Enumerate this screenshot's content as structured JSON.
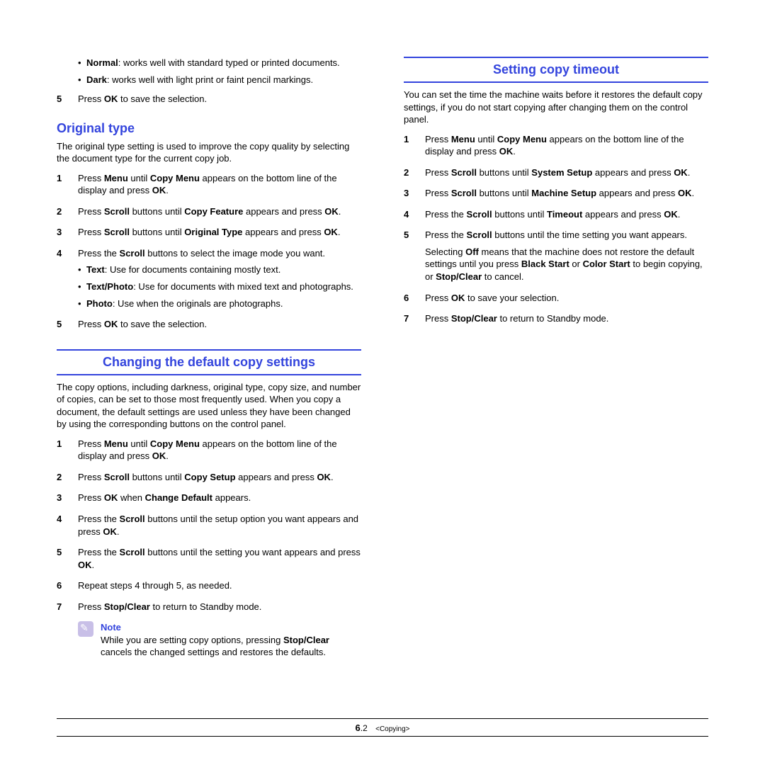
{
  "left": {
    "intro_bullets": [
      {
        "label": "Normal",
        "text": ": works well with standard typed or printed documents."
      },
      {
        "label": "Dark",
        "text": ": works well with light print or faint pencil markings."
      }
    ],
    "step5_a": "Press ",
    "step5_b": "OK",
    "step5_c": " to save the selection.",
    "original_heading": "Original type",
    "original_intro": "The original type setting is used to improve the copy quality by selecting the document type for the current copy job.",
    "o1_a": "Press ",
    "o1_b": "Menu",
    "o1_c": " until ",
    "o1_d": "Copy Menu",
    "o1_e": " appears on the bottom line of the display and press ",
    "o1_f": "OK",
    "o1_g": ".",
    "o2_a": "Press ",
    "o2_b": "Scroll",
    "o2_c": " buttons until ",
    "o2_d": "Copy Feature",
    "o2_e": " appears and press ",
    "o2_f": "OK",
    "o2_g": ".",
    "o3_a": "Press ",
    "o3_b": "Scroll",
    "o3_c": " buttons until ",
    "o3_d": "Original Type",
    "o3_e": " appears and press ",
    "o3_f": "OK",
    "o3_g": ".",
    "o4_a": "Press the ",
    "o4_b": "Scroll",
    "o4_c": " buttons to select the image mode you want.",
    "o4_bullets": [
      {
        "label": "Text",
        "text": ": Use for documents containing mostly text."
      },
      {
        "label": "Text/Photo",
        "text": ": Use for documents with mixed text and photographs."
      },
      {
        "label": "Photo",
        "text": ": Use when the originals are photographs."
      }
    ],
    "o5_a": "Press ",
    "o5_b": "OK",
    "o5_c": " to save the selection.",
    "changing_heading": "Changing the default copy settings",
    "changing_intro": "The copy options, including darkness, original type, copy size, and number of copies, can be set to those most frequently used. When you copy a document, the default settings are used unless they have been changed by using the corresponding buttons on the control panel.",
    "c1_a": "Press ",
    "c1_b": "Menu",
    "c1_c": " until ",
    "c1_d": "Copy Menu",
    "c1_e": " appears on the bottom line of the display and press ",
    "c1_f": "OK",
    "c1_g": ".",
    "c2_a": "Press ",
    "c2_b": "Scroll",
    "c2_c": " buttons until ",
    "c2_d": "Copy Setup",
    "c2_e": " appears and press ",
    "c2_f": "OK",
    "c2_g": ".",
    "c3_a": "Press ",
    "c3_b": "OK",
    "c3_c": " when ",
    "c3_d": "Change Default",
    "c3_e": " appears.",
    "c4_a": "Press the ",
    "c4_b": "Scroll",
    "c4_c": " buttons until the setup option you want appears and press ",
    "c4_d": "OK",
    "c4_e": ".",
    "c5_a": "Press the ",
    "c5_b": "Scroll",
    "c5_c": " buttons until the setting you want appears and press ",
    "c5_d": "OK",
    "c5_e": ".",
    "c6": "Repeat steps 4 through 5, as needed.",
    "c7_a": "Press ",
    "c7_b": "Stop/Clear",
    "c7_c": " to return to Standby mode.",
    "note_title": "Note",
    "note_a": "While you are setting copy options, pressing ",
    "note_b": "Stop/Clear",
    "note_c": " cancels the changed settings and restores the defaults."
  },
  "right": {
    "timeout_heading": "Setting copy timeout",
    "timeout_intro": "You can set the time the machine waits before it restores the default copy settings, if you do not start copying after changing them on the control panel.",
    "t1_a": "Press ",
    "t1_b": "Menu",
    "t1_c": " until ",
    "t1_d": "Copy Menu",
    "t1_e": " appears on the bottom line of the display and press ",
    "t1_f": "OK",
    "t1_g": ".",
    "t2_a": "Press ",
    "t2_b": "Scroll",
    "t2_c": " buttons until ",
    "t2_d": "System Setup",
    "t2_e": " appears and press ",
    "t2_f": "OK",
    "t2_g": ".",
    "t3_a": "Press ",
    "t3_b": "Scroll",
    "t3_c": " buttons until ",
    "t3_d": "Machine Setup",
    "t3_e": " appears and press ",
    "t3_f": "OK",
    "t3_g": ".",
    "t4_a": "Press the ",
    "t4_b": "Scroll",
    "t4_c": " buttons until ",
    "t4_d": "Timeout",
    "t4_e": " appears and press ",
    "t4_f": "OK",
    "t4_g": ".",
    "t5_a": "Press the ",
    "t5_b": "Scroll",
    "t5_c": " buttons until the time setting you want appears.",
    "t5_sub_a": "Selecting ",
    "t5_sub_b": "Off",
    "t5_sub_c": " means that the machine does not restore the default settings until you press ",
    "t5_sub_d": "Black Start",
    "t5_sub_e": " or ",
    "t5_sub_f": "Color Start",
    "t5_sub_g": " to begin copying, or ",
    "t5_sub_h": "Stop/Clear",
    "t5_sub_i": " to cancel.",
    "t6_a": "Press ",
    "t6_b": "OK",
    "t6_c": " to save your selection.",
    "t7_a": "Press ",
    "t7_b": "Stop/Clear",
    "t7_c": " to return to Standby mode."
  },
  "footer": {
    "page_major": "6",
    "page_minor": ".2",
    "chapter": "<Copying>"
  }
}
